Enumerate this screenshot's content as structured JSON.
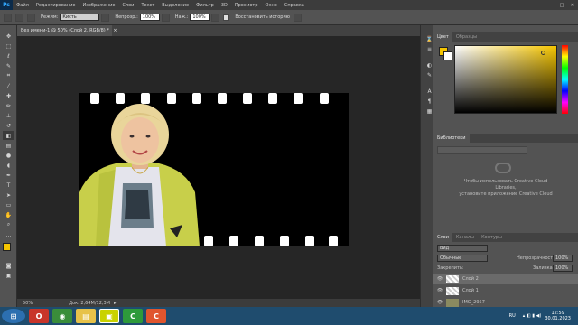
{
  "app": {
    "logo_text": "Ps"
  },
  "menu": {
    "items": [
      "Файл",
      "Редактирование",
      "Изображение",
      "Слои",
      "Текст",
      "Выделение",
      "Фильтр",
      "3D",
      "Просмотр",
      "Окно",
      "Справка"
    ]
  },
  "options_bar": {
    "mode_label": "Режим:",
    "mode_value": "Кисть",
    "pressure_label": "Непрозр.:",
    "pressure_value": "100%",
    "flow_label": "Наж.:",
    "flow_value": "100%",
    "restore_label": "Восстановить историю"
  },
  "document": {
    "tab_title": "Без имени-1 @ 50% (Слой 2, RGB/8) *",
    "zoom": "50%",
    "doc_size": "Док: 2,64M/12,3M"
  },
  "color_panel": {
    "tabs": [
      "Цвет",
      "Образцы"
    ],
    "fg_color": "#f5c500",
    "bg_color": "#ffffff"
  },
  "libraries_panel": {
    "title": "Библиотеки",
    "message_line1": "Чтобы использовать Creative Cloud",
    "message_line2": "Libraries,",
    "message_line3": "установите приложение Creative Cloud"
  },
  "layers_panel": {
    "tabs": [
      "Слои",
      "Каналы",
      "Контуры"
    ],
    "kind": "Вид",
    "blend_mode": "Обычные",
    "opacity_label": "Непрозрачность:",
    "opacity_value": "100%",
    "lock_label": "Закрепить:",
    "fill_label": "Заливка:",
    "fill_value": "100%",
    "layers": [
      {
        "name": "Слой 2"
      },
      {
        "name": "Слой 1"
      },
      {
        "name": "IMG_2957"
      }
    ]
  },
  "taskbar": {
    "lang": "RU",
    "time": "12:59",
    "date": "30.01.2023"
  }
}
